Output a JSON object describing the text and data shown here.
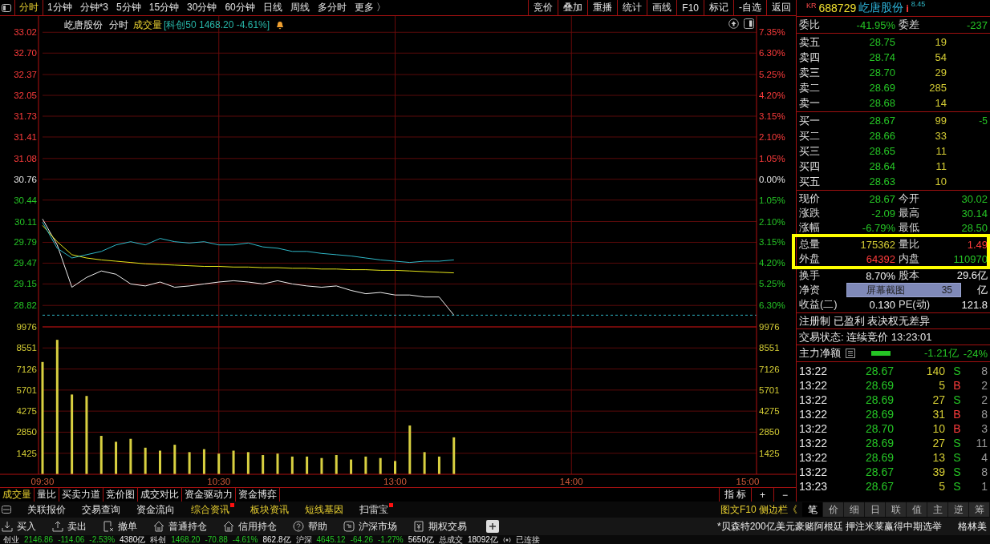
{
  "period_tabs": [
    {
      "label": "分时",
      "selected": true
    },
    {
      "label": "1分钟",
      "selected": false
    },
    {
      "label": "分钟*3",
      "selected": false
    },
    {
      "label": "5分钟",
      "selected": false
    },
    {
      "label": "15分钟",
      "selected": false
    },
    {
      "label": "30分钟",
      "selected": false
    },
    {
      "label": "60分钟",
      "selected": false
    },
    {
      "label": "日线",
      "selected": false
    },
    {
      "label": "周线",
      "selected": false
    },
    {
      "label": "多分时",
      "selected": false
    },
    {
      "label": "更多 〉",
      "selected": false
    }
  ],
  "toolbar_buttons": [
    "竞价",
    "叠加",
    "重播",
    "统计",
    "画线",
    "F10",
    "标记",
    "-自选",
    "返回"
  ],
  "chart_header": {
    "name": "屹唐股份",
    "mode": "分时",
    "indicator": "成交量",
    "index_info": "[科创50 1468.20 -4.61%]"
  },
  "price_chart": {
    "chart_data": {
      "type": "line",
      "grid": true,
      "categories": [
        null,
        null,
        null,
        null,
        null,
        null,
        null,
        null,
        null,
        null,
        null,
        null,
        null,
        null,
        null,
        null,
        null,
        null,
        null,
        null,
        null,
        null,
        null,
        null,
        null,
        null,
        null,
        null,
        null,
        null,
        null,
        null,
        null,
        null,
        null,
        null,
        null,
        null,
        null,
        null,
        null,
        null,
        null,
        null,
        null,
        null,
        null,
        null,
        null
      ],
      "ylim": [
        28.49,
        33.27
      ],
      "yticks": [
        {
          "value": 33.02,
          "label": "33.02"
        },
        {
          "value": 32.7,
          "label": "32.70"
        },
        {
          "value": 32.37,
          "label": "32.37"
        },
        {
          "value": 32.05,
          "label": "32.05"
        },
        {
          "value": 31.73,
          "label": "31.73"
        },
        {
          "value": 31.41,
          "label": "31.41"
        },
        {
          "value": 31.08,
          "label": "31.08"
        },
        {
          "value": 30.76,
          "label": "30.76"
        },
        {
          "value": 30.44,
          "label": "30.44"
        },
        {
          "value": 30.11,
          "label": "30.11"
        },
        {
          "value": 29.79,
          "label": "29.79"
        },
        {
          "value": 29.47,
          "label": "29.47"
        },
        {
          "value": 29.15,
          "label": "29.15"
        },
        {
          "value": 28.82,
          "label": "28.82"
        }
      ],
      "series": [
        {
          "color": "#f0f0f0",
          "values": [
            30.15,
            29.75,
            29.1,
            29.25,
            29.35,
            29.3,
            29.15,
            29.12,
            29.18,
            29.1,
            29.12,
            29.15,
            29.18,
            29.2,
            29.18,
            29.15,
            29.2,
            29.15,
            29.12,
            29.1,
            29.12,
            29.05,
            29.0,
            29.02,
            28.98,
            28.98,
            28.95,
            28.95,
            28.67,
            null,
            null,
            null,
            null,
            null,
            null,
            null,
            null,
            null,
            null,
            null,
            null,
            null,
            null,
            null,
            null,
            null,
            null,
            null,
            null
          ]
        },
        {
          "color": "#e6e619",
          "values": [
            30.05,
            29.8,
            29.6,
            29.55,
            29.52,
            29.5,
            29.48,
            29.46,
            29.45,
            29.44,
            29.43,
            29.42,
            29.42,
            29.41,
            29.41,
            29.4,
            29.4,
            29.39,
            29.39,
            29.38,
            29.38,
            29.37,
            29.37,
            29.36,
            29.36,
            29.35,
            29.34,
            29.33,
            29.32,
            null,
            null,
            null,
            null,
            null,
            null,
            null,
            null,
            null,
            null,
            null,
            null,
            null,
            null,
            null,
            null,
            null,
            null,
            null,
            null
          ]
        },
        {
          "color": "#2fb8c8",
          "values": [
            30.1,
            29.7,
            29.55,
            29.6,
            29.65,
            29.75,
            29.8,
            29.75,
            29.85,
            29.8,
            29.78,
            29.8,
            29.75,
            29.75,
            29.78,
            29.72,
            29.7,
            29.65,
            29.65,
            29.62,
            29.6,
            29.58,
            29.55,
            29.52,
            29.5,
            29.48,
            29.5,
            29.5,
            29.52,
            null,
            null,
            null,
            null,
            null,
            null,
            null,
            null,
            null,
            null,
            null,
            null,
            null,
            null,
            null,
            null,
            null,
            null,
            null,
            null
          ]
        }
      ]
    },
    "percent_axis": [
      {
        "label": "7.35%",
        "kind": "up"
      },
      {
        "label": "6.30%",
        "kind": "up"
      },
      {
        "label": "5.25%",
        "kind": "up"
      },
      {
        "label": "4.20%",
        "kind": "up"
      },
      {
        "label": "3.15%",
        "kind": "up"
      },
      {
        "label": "2.10%",
        "kind": "up"
      },
      {
        "label": "1.05%",
        "kind": "up"
      },
      {
        "label": "0.00%",
        "kind": "flat"
      },
      {
        "label": "1.05%",
        "kind": "down"
      },
      {
        "label": "2.10%",
        "kind": "down"
      },
      {
        "label": "3.15%",
        "kind": "down"
      },
      {
        "label": "4.20%",
        "kind": "down"
      },
      {
        "label": "5.25%",
        "kind": "down"
      },
      {
        "label": "6.30%",
        "kind": "down"
      }
    ]
  },
  "volume_chart": {
    "chart_data": {
      "type": "bar",
      "grid": true,
      "categories": [
        "09:30",
        null,
        null,
        null,
        null,
        null,
        null,
        null,
        null,
        null,
        null,
        null,
        "10:30",
        null,
        null,
        null,
        null,
        null,
        null,
        null,
        null,
        null,
        null,
        null,
        "13:00",
        null,
        null,
        null,
        null,
        null,
        null,
        null,
        null,
        null,
        null,
        null,
        "14:00",
        null,
        null,
        null,
        null,
        null,
        null,
        null,
        null,
        null,
        null,
        null,
        "15:00"
      ],
      "ylim": [
        0,
        9976
      ],
      "yticks": [
        1425,
        2850,
        4275,
        5701,
        7126,
        8551,
        9976
      ],
      "series": [
        {
          "color": "#d8d040",
          "values": [
            7600,
            9100,
            5400,
            5300,
            2600,
            2200,
            2400,
            1800,
            1600,
            2000,
            1500,
            1700,
            1400,
            1600,
            1500,
            1300,
            1400,
            1200,
            1200,
            1100,
            1300,
            1000,
            1200,
            1100,
            900,
            3300,
            1500,
            1200,
            2500,
            null,
            null,
            null,
            null,
            null,
            null,
            null,
            null,
            null,
            null,
            null,
            null,
            null,
            null,
            null,
            null,
            null,
            null,
            null,
            null
          ]
        }
      ]
    },
    "right_axis": [
      "9976",
      "8551",
      "7126",
      "5701",
      "4275",
      "2850",
      "1425"
    ]
  },
  "indicator_tabs": [
    {
      "label": "成交量",
      "selected": true
    },
    {
      "label": "量比",
      "selected": false
    },
    {
      "label": "买卖力道",
      "selected": false
    },
    {
      "label": "竞价图",
      "selected": false
    },
    {
      "label": "成交对比",
      "selected": false
    },
    {
      "label": "资金驱动力",
      "selected": false
    },
    {
      "label": "资金博弈",
      "selected": false
    }
  ],
  "indicator_buttons": [
    "指 标",
    "+",
    "−"
  ],
  "quote_header": {
    "market": "KR",
    "code": "688729",
    "name": "屹唐股份",
    "info": "i",
    "superscript": "8.45"
  },
  "order_ratio": {
    "cells": [
      {
        "text": "委比",
        "kind": "label"
      },
      {
        "text": "-41.95%",
        "kind": "down"
      },
      {
        "text": "委差",
        "kind": "label"
      },
      {
        "text": "-237",
        "kind": "down"
      }
    ]
  },
  "asks": [
    {
      "label": "卖五",
      "price": {
        "text": "28.75",
        "kind": "down"
      },
      "volume": "19"
    },
    {
      "label": "卖四",
      "price": {
        "text": "28.74",
        "kind": "down"
      },
      "volume": "54"
    },
    {
      "label": "卖三",
      "price": {
        "text": "28.70",
        "kind": "down"
      },
      "volume": "29"
    },
    {
      "label": "卖二",
      "price": {
        "text": "28.69",
        "kind": "down"
      },
      "volume": "285"
    },
    {
      "label": "卖一",
      "price": {
        "text": "28.68",
        "kind": "down"
      },
      "volume": "14"
    }
  ],
  "bids": [
    {
      "label": "买一",
      "price": {
        "text": "28.67",
        "kind": "down"
      },
      "volume": "99",
      "change": "-5"
    },
    {
      "label": "买二",
      "price": {
        "text": "28.66",
        "kind": "down"
      },
      "volume": "33"
    },
    {
      "label": "买三",
      "price": {
        "text": "28.65",
        "kind": "down"
      },
      "volume": "11"
    },
    {
      "label": "买四",
      "price": {
        "text": "28.64",
        "kind": "down"
      },
      "volume": "11"
    },
    {
      "label": "买五",
      "price": {
        "text": "28.63",
        "kind": "down"
      },
      "volume": "10"
    }
  ],
  "quote_rows": [
    {
      "cells": [
        {
          "text": "现价",
          "kind": "label"
        },
        {
          "text": "28.67",
          "kind": "down"
        },
        {
          "text": "今开",
          "kind": "label"
        },
        {
          "text": "30.02",
          "kind": "down"
        }
      ]
    },
    {
      "cells": [
        {
          "text": "涨跌",
          "kind": "label"
        },
        {
          "text": "-2.09",
          "kind": "down"
        },
        {
          "text": "最高",
          "kind": "label"
        },
        {
          "text": "30.14",
          "kind": "down"
        }
      ]
    },
    {
      "cells": [
        {
          "text": "涨幅",
          "kind": "label"
        },
        {
          "text": "-6.79%",
          "kind": "down"
        },
        {
          "text": "最低",
          "kind": "label"
        },
        {
          "text": "28.50",
          "kind": "down"
        }
      ]
    }
  ],
  "volume_rows": {
    "highlighted": true,
    "rows": [
      {
        "cells": [
          {
            "text": "总量",
            "kind": "label"
          },
          {
            "text": "175362",
            "kind": "volume"
          },
          {
            "text": "量比",
            "kind": "label"
          },
          {
            "text": "1.49",
            "kind": "up"
          }
        ]
      },
      {
        "cells": [
          {
            "text": "外盘",
            "kind": "label"
          },
          {
            "text": "64392",
            "kind": "up"
          },
          {
            "text": "内盘",
            "kind": "label"
          },
          {
            "text": "110970",
            "kind": "down"
          }
        ]
      }
    ]
  },
  "stat_rows": [
    {
      "cells": [
        {
          "text": "换手",
          "kind": "label"
        },
        {
          "text": "8.70%",
          "kind": "plain"
        },
        {
          "text": "股本",
          "kind": "label"
        },
        {
          "text": "29.6亿",
          "kind": "plain"
        }
      ]
    },
    {
      "cells": [
        {
          "text": "净资",
          "kind": "label"
        },
        {
          "text": "亿",
          "kind": "plain"
        }
      ],
      "overlay": {
        "text": "屏幕截图",
        "extra": "35"
      }
    },
    {
      "cells": [
        {
          "text": "收益(二)",
          "kind": "label"
        },
        {
          "text": "0.130",
          "kind": "plain"
        },
        {
          "text": "PE(动)",
          "kind": "label"
        },
        {
          "text": "121.8",
          "kind": "plain"
        }
      ]
    }
  ],
  "tags_line": "注册制 已盈利 表决权无差异",
  "trade_status": "交易状态: 连续竞价 13:23:01",
  "main_flow": {
    "label": "主力净额",
    "amount": "-1.21亿",
    "percent": "-24%",
    "kind": "down"
  },
  "ticks": [
    {
      "time": "13:22",
      "price": {
        "text": "28.67",
        "kind": "down"
      },
      "volume": "140",
      "side": {
        "text": "S",
        "kind": "sell"
      },
      "count": "8"
    },
    {
      "time": "13:22",
      "price": {
        "text": "28.69",
        "kind": "down"
      },
      "volume": "5",
      "side": {
        "text": "B",
        "kind": "buy"
      },
      "count": "2"
    },
    {
      "time": "13:22",
      "price": {
        "text": "28.69",
        "kind": "down"
      },
      "volume": "27",
      "side": {
        "text": "S",
        "kind": "sell"
      },
      "count": "2"
    },
    {
      "time": "13:22",
      "price": {
        "text": "28.69",
        "kind": "down"
      },
      "volume": "31",
      "side": {
        "text": "B",
        "kind": "buy"
      },
      "count": "8"
    },
    {
      "time": "13:22",
      "price": {
        "text": "28.70",
        "kind": "down"
      },
      "volume": "10",
      "side": {
        "text": "B",
        "kind": "buy"
      },
      "count": "3"
    },
    {
      "time": "13:22",
      "price": {
        "text": "28.69",
        "kind": "down"
      },
      "volume": "27",
      "side": {
        "text": "S",
        "kind": "sell"
      },
      "count": "11"
    },
    {
      "time": "13:22",
      "price": {
        "text": "28.69",
        "kind": "down"
      },
      "volume": "13",
      "side": {
        "text": "S",
        "kind": "sell"
      },
      "count": "4"
    },
    {
      "time": "13:22",
      "price": {
        "text": "28.67",
        "kind": "down"
      },
      "volume": "39",
      "side": {
        "text": "S",
        "kind": "sell"
      },
      "count": "8"
    },
    {
      "time": "13:23",
      "price": {
        "text": "28.67",
        "kind": "down"
      },
      "volume": "5",
      "side": {
        "text": "S",
        "kind": "sell"
      },
      "count": "1"
    }
  ],
  "nav_items": [
    {
      "label": "关联报价",
      "highlighted": false,
      "dot": false
    },
    {
      "label": "交易查询",
      "highlighted": false,
      "dot": false
    },
    {
      "label": "资金流向",
      "highlighted": false,
      "dot": false
    },
    {
      "label": "综合资讯",
      "highlighted": true,
      "dot": true
    },
    {
      "label": "板块资讯",
      "highlighted": true,
      "dot": false
    },
    {
      "label": "短线基因",
      "highlighted": true,
      "dot": false
    },
    {
      "label": "扫雷宝",
      "highlighted": false,
      "dot": true
    }
  ],
  "side_link": "图文F10 侧边栏《",
  "side_tabs": [
    {
      "label": "笔",
      "selected": true
    },
    {
      "label": "价",
      "selected": false
    },
    {
      "label": "细",
      "selected": false
    },
    {
      "label": "日",
      "selected": false
    },
    {
      "label": "联",
      "selected": false
    },
    {
      "label": "值",
      "selected": false
    },
    {
      "label": "主",
      "selected": false
    },
    {
      "label": "逆",
      "selected": false
    },
    {
      "label": "筹",
      "selected": false
    }
  ],
  "trade_buttons": [
    {
      "label": "买入",
      "kind": "download"
    },
    {
      "label": "卖出",
      "kind": "upload"
    },
    {
      "label": "撤单",
      "kind": "cancel"
    },
    {
      "label": "普通持仓",
      "kind": "house"
    },
    {
      "label": "信用持仓",
      "kind": "house"
    },
    {
      "label": "帮助",
      "kind": "help"
    },
    {
      "label": "沪深市场",
      "kind": "market"
    },
    {
      "label": "期权交易",
      "kind": "yen"
    }
  ],
  "news_ticker": "*贝森特200亿美元豪赌阿根廷 押注米莱赢得中期选举",
  "news_stock": "格林美",
  "status_items": [
    {
      "text": "创业",
      "kind": "label"
    },
    {
      "text": "2146.86",
      "kind": "down"
    },
    {
      "text": "-114.06",
      "kind": "down"
    },
    {
      "text": "-2.53%",
      "kind": "down"
    },
    {
      "text": "4380亿",
      "kind": "plain"
    },
    {
      "text": "科创",
      "kind": "label"
    },
    {
      "text": "1468.20",
      "kind": "down"
    },
    {
      "text": "-70.88",
      "kind": "down"
    },
    {
      "text": "-4.61%",
      "kind": "down"
    },
    {
      "text": "862.8亿",
      "kind": "plain"
    },
    {
      "text": "沪深",
      "kind": "label"
    },
    {
      "text": "4645.12",
      "kind": "down"
    },
    {
      "text": "-64.26",
      "kind": "down"
    },
    {
      "text": "-1.27%",
      "kind": "down"
    },
    {
      "text": "5650亿",
      "kind": "plain"
    },
    {
      "text": "总成交",
      "kind": "label"
    },
    {
      "text": "18092亿",
      "kind": "plain"
    }
  ],
  "connection": "已连接"
}
